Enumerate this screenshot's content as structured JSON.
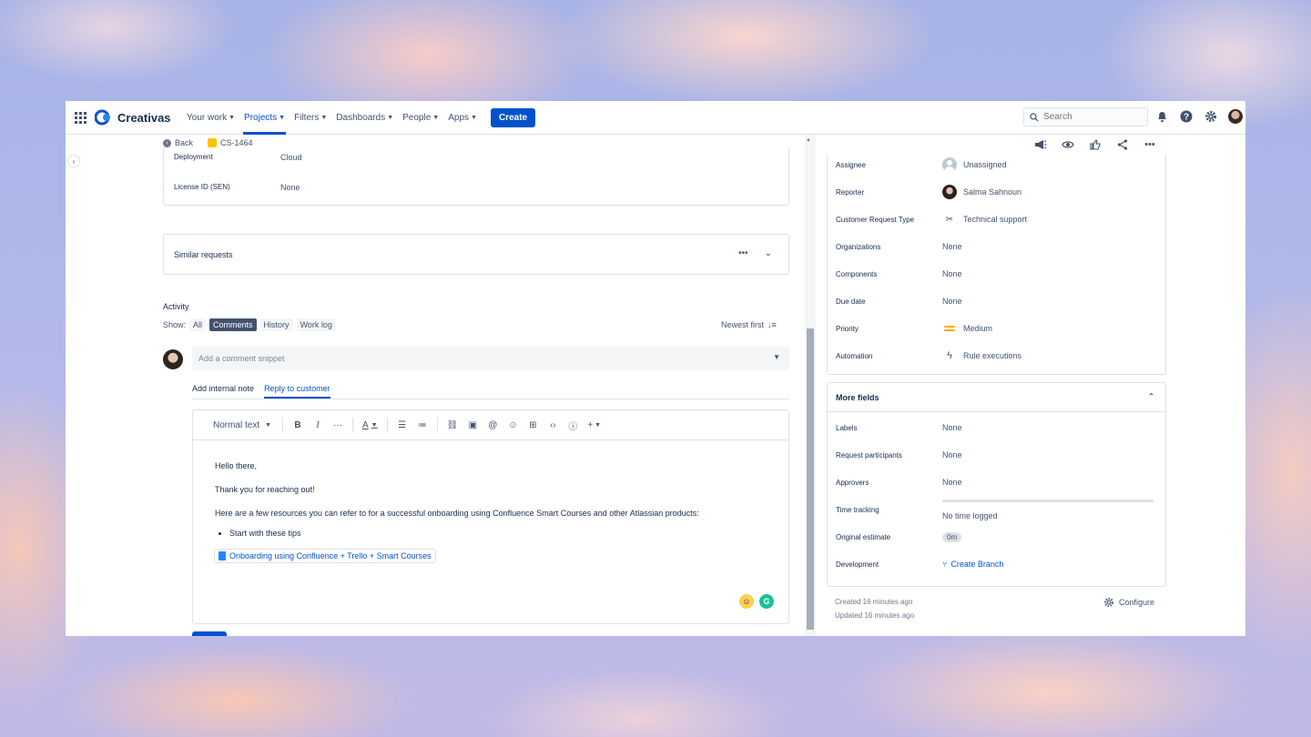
{
  "app": {
    "name": "Creativas"
  },
  "nav": {
    "items": [
      {
        "label": "Your work",
        "active": false
      },
      {
        "label": "Projects",
        "active": true
      },
      {
        "label": "Filters",
        "active": false
      },
      {
        "label": "Dashboards",
        "active": false
      },
      {
        "label": "People",
        "active": false
      },
      {
        "label": "Apps",
        "active": false
      }
    ],
    "create_label": "Create",
    "search_placeholder": "Search"
  },
  "breadcrumb": {
    "back_label": "Back",
    "issue_key": "CS-1464"
  },
  "details": {
    "deployment_label": "Deployment",
    "deployment_value": "Cloud",
    "license_label": "License ID (SEN)",
    "license_value": "None"
  },
  "similar": {
    "label": "Similar requests"
  },
  "activity": {
    "title": "Activity",
    "show_label": "Show:",
    "filters": [
      "All",
      "Comments",
      "History",
      "Work log"
    ],
    "active_filter": "Comments",
    "sort_label": "Newest first"
  },
  "comment": {
    "snippet_placeholder": "Add a comment snippet",
    "tabs": [
      "Add internal note",
      "Reply to customer"
    ],
    "active_tab": "Reply to customer",
    "text_style": "Normal text",
    "body": {
      "greeting": "Hello there,",
      "thanks": "Thank you for reaching out!",
      "intro": "Here are a few resources you can refer to for a successful onboarding using Confluence Smart Courses and other Atlassian products:",
      "bullet": "Start with these tips",
      "link": "Onboarding using Confluence + Trello + Smart Courses"
    }
  },
  "fields": {
    "assignee": {
      "label": "Assignee",
      "value": "Unassigned"
    },
    "reporter": {
      "label": "Reporter",
      "value": "Salma Sahnoun"
    },
    "request_type": {
      "label": "Customer Request Type",
      "value": "Technical support"
    },
    "organizations": {
      "label": "Organizations",
      "value": "None"
    },
    "components": {
      "label": "Components",
      "value": "None"
    },
    "due_date": {
      "label": "Due date",
      "value": "None"
    },
    "priority": {
      "label": "Priority",
      "value": "Medium"
    },
    "automation": {
      "label": "Automation",
      "value": "Rule executions"
    }
  },
  "more_fields": {
    "title": "More fields",
    "labels": {
      "label": "Labels",
      "value": "None"
    },
    "participants": {
      "label": "Request participants",
      "value": "None"
    },
    "approvers": {
      "label": "Approvers",
      "value": "None"
    },
    "time_tracking": {
      "label": "Time tracking",
      "value": "No time logged"
    },
    "estimate": {
      "label": "Original estimate",
      "value": "0m"
    },
    "development": {
      "label": "Development",
      "value": "Create Branch"
    }
  },
  "meta": {
    "created": "Created 16 minutes ago",
    "updated": "Updated 16 minutes ago",
    "configure_label": "Configure"
  },
  "colors": {
    "brand": "#0052cc",
    "priority_medium": "#ffab00"
  }
}
